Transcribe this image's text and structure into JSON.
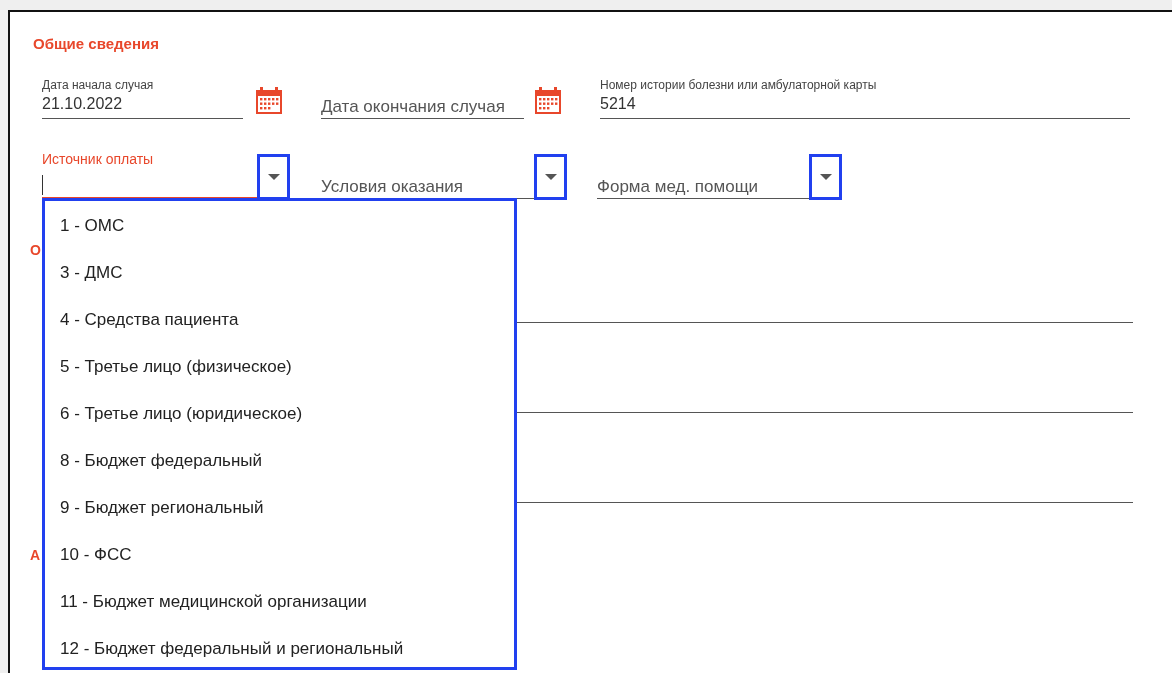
{
  "section_title": "Общие сведения",
  "date_fields": [
    {
      "label": "Дата начала случая",
      "value": "21.10.2022"
    },
    {
      "placeholder": "Дата окончания случая"
    }
  ],
  "record_field": {
    "label": "Номер истории болезни или амбулаторной карты",
    "value": "5214"
  },
  "selects": [
    {
      "label": "Источник оплаты",
      "focused": true
    },
    {
      "placeholder": "Условия оказания",
      "focused": false
    },
    {
      "placeholder": "Форма мед. помощи",
      "focused": false
    }
  ],
  "covered_sections": [
    {
      "title": "О"
    },
    {
      "title": "А"
    }
  ],
  "dropdown": {
    "options": [
      {
        "text": "1 - ОМС"
      },
      {
        "text": "3 - ДМС"
      },
      {
        "text": "4 - Средства пациента"
      },
      {
        "text": "5 - Третье лицо (физическое)"
      },
      {
        "text": "6 - Третье лицо (юридическое)"
      },
      {
        "text": "8 - Бюджет федеральный"
      },
      {
        "text": "9 - Бюджет региональный"
      },
      {
        "text": "10 - ФСС"
      },
      {
        "text": "11 - Бюджет медицинской организации"
      },
      {
        "text": "12 - Бюджет федеральный и региональный"
      }
    ]
  }
}
